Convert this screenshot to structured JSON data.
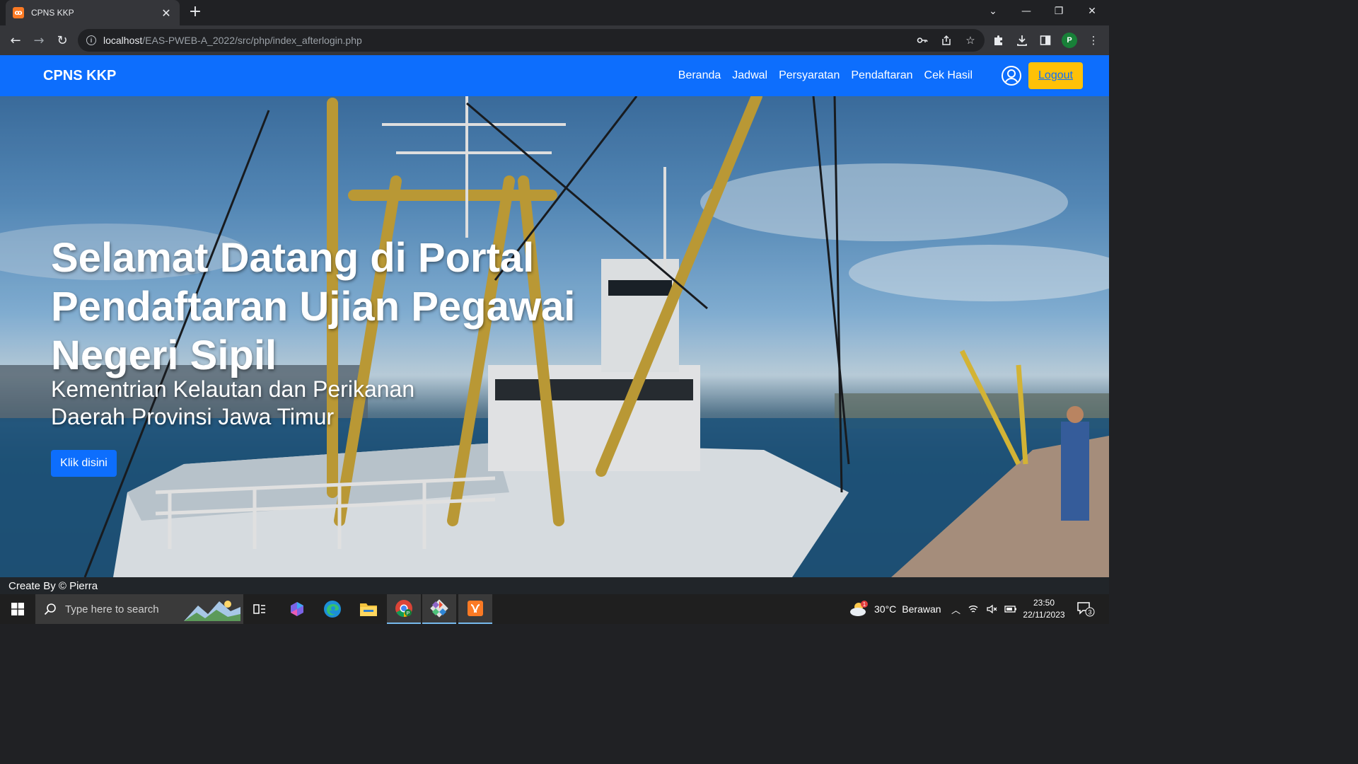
{
  "browser": {
    "tab": {
      "title": "CPNS KKP",
      "favicon": "xampp-icon"
    },
    "new_tab_label": "+",
    "url": {
      "host": "localhost",
      "path": "/EAS-PWEB-A_2022/src/php/index_afterlogin.php"
    },
    "profile_initial": "P"
  },
  "site": {
    "brand": "CPNS KKP",
    "nav": [
      "Beranda",
      "Jadwal",
      "Persyaratan",
      "Pendaftaran",
      "Cek Hasil"
    ],
    "logout_label": "Logout",
    "hero": {
      "title": "Selamat Datang di Portal Pendaftaran Ujian Pegawai Negeri Sipil",
      "subtitle_line1": "Kementrian Kelautan dan Perikanan",
      "subtitle_line2": "Daerah Provinsi Jawa Timur",
      "button_label": "Klik disini"
    },
    "footer": "Create By © Pierra",
    "colors": {
      "primary": "#0d6efd",
      "warning": "#ffc107",
      "footer": "#212529"
    }
  },
  "taskbar": {
    "search_placeholder": "Type here to search",
    "weather": {
      "temp": "30°C",
      "condition": "Berawan"
    },
    "time": "23:50",
    "date": "22/11/2023",
    "notification_count": "3",
    "weather_badge": "1",
    "apps": [
      "task-view-icon",
      "copilot-icon",
      "edge-icon",
      "file-explorer-icon",
      "chrome-icon",
      "git-icon",
      "xampp-icon"
    ]
  }
}
